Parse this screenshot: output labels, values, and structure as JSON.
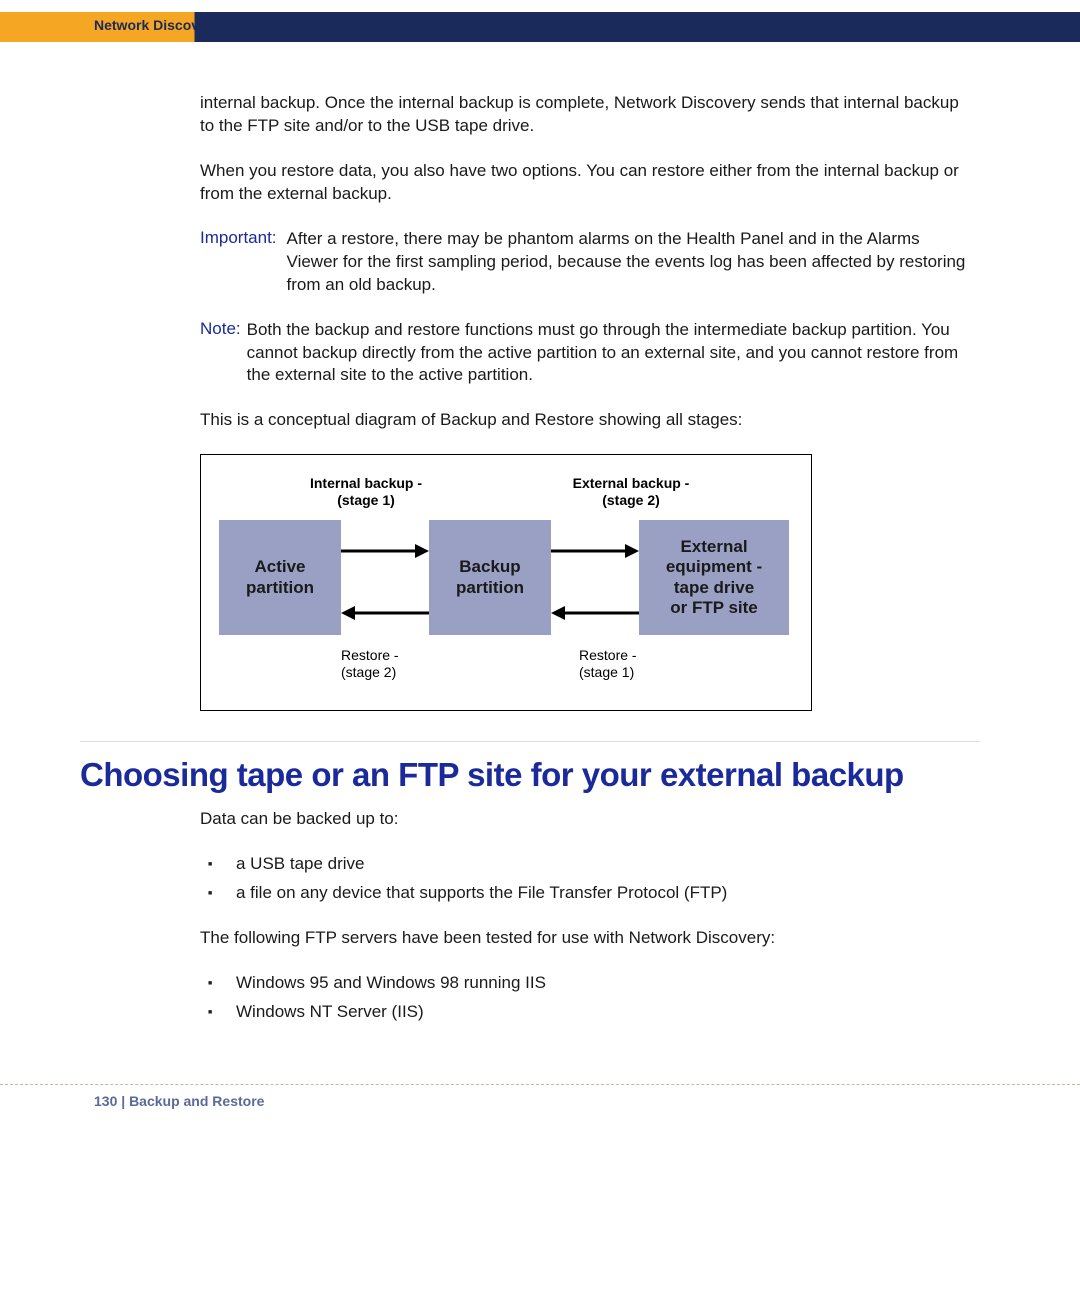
{
  "header": {
    "product": "Network Discovery"
  },
  "body": {
    "para1": "internal backup. Once the internal backup is complete, Network Discovery sends that internal backup to the FTP site and/or to the USB tape drive.",
    "para2": "When you restore data, you also have two options. You can restore either from the internal backup or from the external backup.",
    "important_label": "Important:",
    "important_text": "After a restore, there may be phantom alarms on the Health Panel and in the Alarms Viewer for the first sampling period, because the events log has been affected by restoring from an old backup.",
    "note_label": "Note:",
    "note_text": "Both the backup and restore functions must go through the intermediate backup partition. You cannot backup directly from the active partition to an external site, and you cannot restore from the external site to the active partition.",
    "para3": "This is a conceptual diagram of Backup and Restore showing all stages:"
  },
  "diagram": {
    "box1": "Active\npartition",
    "box2": "Backup\npartition",
    "box3": "External\nequipment -\ntape drive\nor FTP site",
    "lbl_top_left": "Internal backup -\n(stage 1)",
    "lbl_top_right": "External backup -\n(stage 2)",
    "lbl_bot_left": "Restore -\n(stage 2)",
    "lbl_bot_right": "Restore -\n(stage 1)"
  },
  "section": {
    "title": "Choosing tape or an FTP site for your external backup",
    "intro": "Data can be backed up to:",
    "list1": [
      "a USB tape drive",
      "a file on any device that supports the File Transfer Protocol (FTP)"
    ],
    "para4": "The following FTP servers have been tested for use with Network Discovery:",
    "list2": [
      "Windows 95 and Windows 98 running IIS",
      "Windows NT Server (IIS)"
    ]
  },
  "footer": {
    "page": "130",
    "chapter": "Backup and Restore"
  }
}
